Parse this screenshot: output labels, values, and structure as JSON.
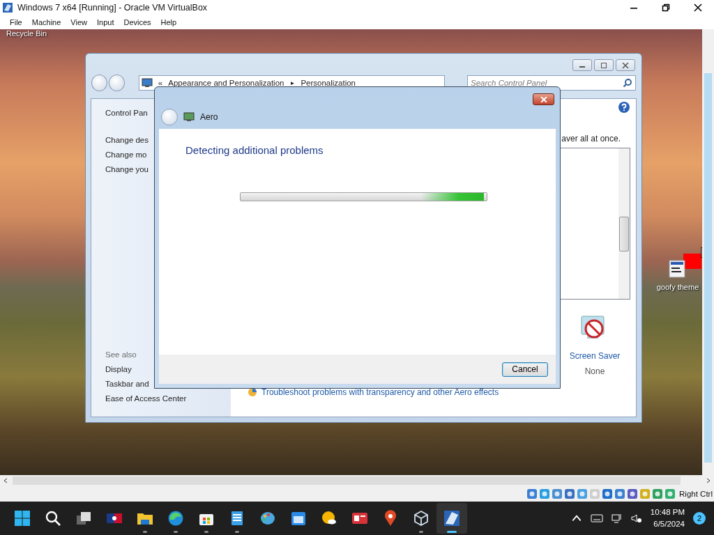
{
  "host_window": {
    "title": "Windows 7 x64 [Running] - Oracle VM VirtualBox"
  },
  "menu": [
    "File",
    "Machine",
    "View",
    "Input",
    "Devices",
    "Help"
  ],
  "desktop": {
    "recycle_bin_label": "Recycle Bin",
    "shortcut_label": "goofy theme"
  },
  "control_panel": {
    "address": {
      "overflow": "«",
      "crumbs": [
        "Appearance and Personalization",
        "Personalization"
      ],
      "separator": "►"
    },
    "search_placeholder": "Search Control Panel",
    "left_links": [
      "Control Pan",
      "Change des",
      "Change mo",
      "Change you"
    ],
    "see_also": {
      "heading": "See also",
      "links": [
        "Display",
        "Taskbar and",
        "Ease of Access Center"
      ]
    },
    "intro_fragment": "aver all at once.",
    "screen_saver": {
      "label": "Screen Saver",
      "value": "None"
    },
    "troubleshoot_link": "Troubleshoot problems with transparency and other Aero effects"
  },
  "dialog": {
    "title": "Aero",
    "heading": "Detecting additional problems",
    "progress": {
      "level": 0.99
    },
    "buttons": [
      "Cancel"
    ]
  },
  "status_bar": {
    "host_key": "Right Ctrl"
  },
  "taskbar": {
    "apps": [
      {
        "kind": "start",
        "open": false,
        "selected": false
      },
      {
        "kind": "search",
        "open": false,
        "selected": false
      },
      {
        "kind": "taskview",
        "open": false,
        "selected": false
      },
      {
        "kind": "sports",
        "open": false,
        "selected": false
      },
      {
        "kind": "folder",
        "open": true,
        "selected": false
      },
      {
        "kind": "browser",
        "open": true,
        "selected": false
      },
      {
        "kind": "store",
        "open": true,
        "selected": false
      },
      {
        "kind": "notepad",
        "open": true,
        "selected": false
      },
      {
        "kind": "paint",
        "open": false,
        "selected": false
      },
      {
        "kind": "calendar",
        "open": false,
        "selected": false
      },
      {
        "kind": "weather",
        "open": false,
        "selected": false
      },
      {
        "kind": "news",
        "open": false,
        "selected": false
      },
      {
        "kind": "maps",
        "open": false,
        "selected": false
      },
      {
        "kind": "cube",
        "open": true,
        "selected": false
      },
      {
        "kind": "vm",
        "open": true,
        "selected": true
      }
    ],
    "time": "10:48 PM",
    "date": "6/5/2024",
    "notification_count": "2"
  }
}
